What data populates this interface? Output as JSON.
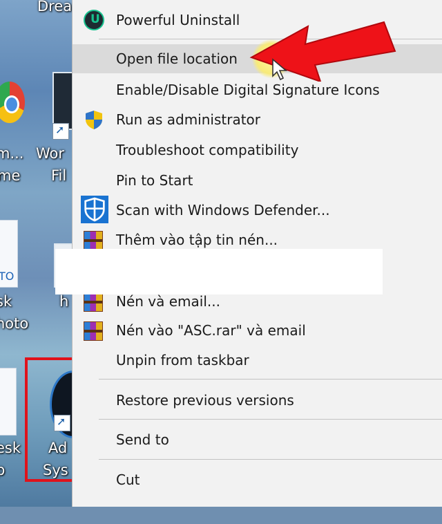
{
  "desktop": {
    "top_label": "Dream - S",
    "chrome_label": [
      "m...",
      "me"
    ],
    "word_label": [
      "Wor",
      "Fil"
    ],
    "photo_label": [
      "TO",
      "sk",
      "hoto"
    ],
    "h_label": "h",
    "bottom_left_label": [
      "esk",
      "p"
    ],
    "adobe_label": [
      "Ad",
      "Sys"
    ]
  },
  "menu": {
    "items": [
      {
        "label": "Powerful Uninstall",
        "icon": "uninstall-icon"
      },
      {
        "label": "Open file location",
        "icon": null
      },
      {
        "label": "Enable/Disable Digital Signature Icons",
        "icon": null
      },
      {
        "label": "Run as administrator",
        "icon": "shield-uac-icon"
      },
      {
        "label": "Troubleshoot compatibility",
        "icon": null
      },
      {
        "label": "Pin to Start",
        "icon": null
      },
      {
        "label": "Scan with Windows Defender...",
        "icon": "windows-defender-icon"
      },
      {
        "label": "Thêm vào tập tin nén...",
        "icon": "winrar-icon"
      },
      {
        "label": "Nén và email...",
        "icon": "winrar-icon"
      },
      {
        "label": "Nén vào \"ASC.rar\" và email",
        "icon": "winrar-icon"
      },
      {
        "label": "Unpin from taskbar",
        "icon": null
      },
      {
        "label": "Restore previous versions",
        "icon": null
      },
      {
        "label": "Send to",
        "icon": null
      },
      {
        "label": "Cut",
        "icon": null
      }
    ],
    "highlighted": "Open file location"
  },
  "colors": {
    "annotation_red": "#e0121b",
    "menu_bg": "#f2f2f2",
    "hover_bg": "#dadada"
  }
}
